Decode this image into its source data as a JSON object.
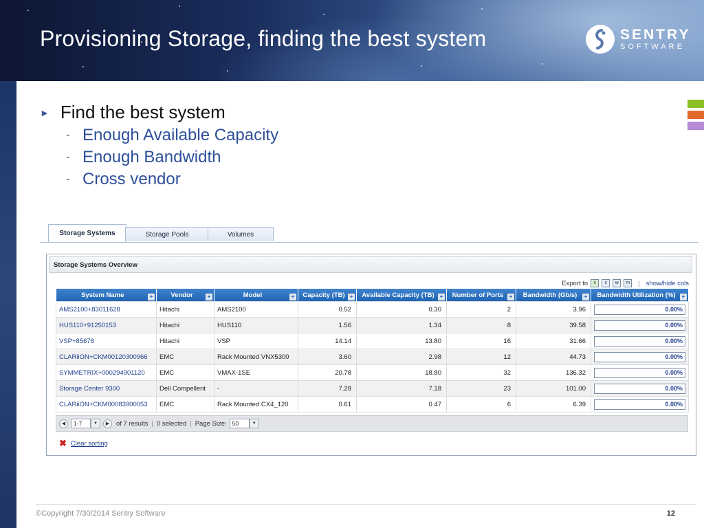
{
  "slide": {
    "title": "Provisioning Storage, finding the best system",
    "logo_name": "SENTRY",
    "logo_sub": "SOFTWARE",
    "accent_colors": [
      "#8cbf26",
      "#e06a2b",
      "#b58ad6"
    ]
  },
  "bullets": {
    "main": "Find the best system",
    "subs": [
      "Enough Available Capacity",
      "Enough Bandwidth",
      "Cross vendor"
    ]
  },
  "tabs": [
    "Storage Systems",
    "Storage Pools",
    "Volumes"
  ],
  "panel": {
    "title": "Storage Systems Overview",
    "export_label": "Export to",
    "showhide_label": "show/hide cols"
  },
  "table": {
    "columns": [
      "System Name",
      "Vendor",
      "Model",
      "Capacity (TB)",
      "Available Capacity (TB)",
      "Number of Ports",
      "Bandwidth (Gb/s)",
      "Bandwidth Utilization (%)"
    ],
    "rows": [
      [
        "AMS2100+83011628",
        "Hitachi",
        "AMS2100",
        "0.52",
        "0.30",
        "2",
        "3.96",
        "0.00%"
      ],
      [
        "HUS110+91250153",
        "Hitachi",
        "HUS110",
        "1.56",
        "1.34",
        "8",
        "39.58",
        "0.00%"
      ],
      [
        "VSP+85678",
        "Hitachi",
        "VSP",
        "14.14",
        "13.80",
        "16",
        "31.66",
        "0.00%"
      ],
      [
        "CLARiiON+CKM00120300966",
        "EMC",
        "Rack Mounted VNX5300",
        "3.60",
        "2.98",
        "12",
        "44.73",
        "0.00%"
      ],
      [
        "SYMMETRIX+000294901120",
        "EMC",
        "VMAX-1SE",
        "20.78",
        "18.80",
        "32",
        "136.32",
        "0.00%"
      ],
      [
        "Storage Center 9300",
        "Dell Compellent",
        "-",
        "7.28",
        "7.18",
        "23",
        "101.00",
        "0.00%"
      ],
      [
        "CLARiiON+CKM00083900053",
        "EMC",
        "Rack Mounted CX4_120",
        "0.61",
        "0.47",
        "6",
        "6.39",
        "0.00%"
      ]
    ]
  },
  "pager": {
    "page_value": "1-7",
    "results": "of 7 results",
    "selected": "0 selected",
    "page_size_label": "Page Size:",
    "page_size_value": "50"
  },
  "clear_sorting": "Clear sorting",
  "footer": {
    "copyright": "©Copyright 7/30/2014 Sentry Software",
    "page_number": "12"
  }
}
